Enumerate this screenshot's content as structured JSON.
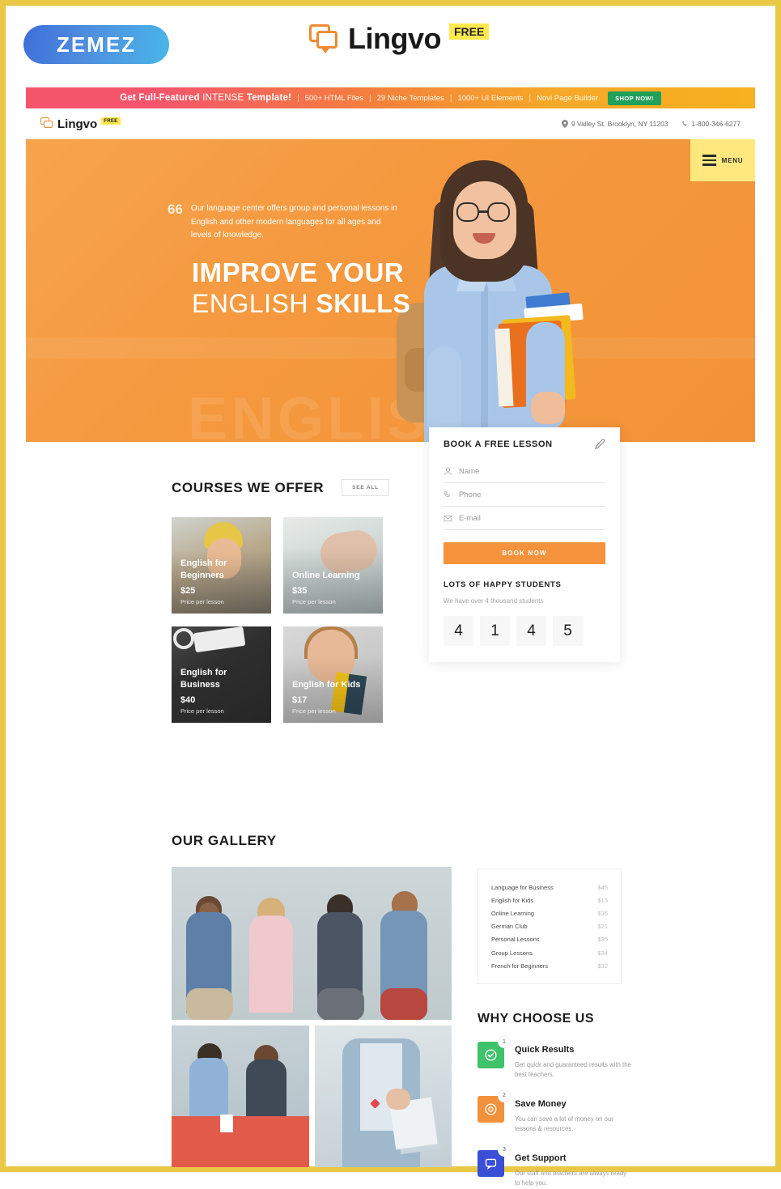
{
  "brand": {
    "zemez_label": "ZEMEZ",
    "logo_word": "Lingvo",
    "free_badge": "FREE"
  },
  "promo": {
    "headline_plain": "Get Full-Featured ",
    "headline_accent": "INTENSE",
    "headline_tail": " Template!",
    "items": [
      "500+ HTML Files",
      "29 Niche Templates",
      "1000+ UI Elements",
      "Novi Page Builder"
    ],
    "cta": "SHOP NOW!",
    "separator": "|"
  },
  "header": {
    "logo_word": "Lingvo",
    "free_badge": "FREE",
    "address": "9 Valley St. Brooklyn, NY 11203",
    "phone": "1-800-346-6277",
    "menu_label": "MENU"
  },
  "hero": {
    "quote_mark": "66",
    "quote_text": "Our language center offers group and personal lessons in English and other modern languages for all ages and levels of knowledge.",
    "title_line1": "IMPROVE YOUR",
    "title_line2_light": "ENGLISH",
    "title_line2_bold": "SKILLS",
    "ghost_text": "ENGLISH",
    "accent_color": "#f5993f",
    "menu_bg": "#ffe97f"
  },
  "booking": {
    "title": "BOOK A FREE LESSON",
    "fields": [
      {
        "name": "Name",
        "placeholder": "Name",
        "value": "",
        "icon": "user-icon"
      },
      {
        "name": "Phone",
        "placeholder": "Phone",
        "value": "",
        "icon": "phone-icon"
      },
      {
        "name": "E-mail",
        "placeholder": "E-mail",
        "value": "",
        "icon": "mail-icon"
      }
    ],
    "submit_label": "BOOK NOW",
    "stats_title": "LOTS OF HAPPY STUDENTS",
    "stats_sub": "We have over 4 thousand students",
    "counter_digits": [
      "4",
      "1",
      "4",
      "5"
    ]
  },
  "courses": {
    "title": "COURSES WE OFFER",
    "see_all": "SEE ALL",
    "items": [
      {
        "name": "English for Beginners",
        "price": "$25",
        "per": "Price per lesson"
      },
      {
        "name": "Online Learning",
        "price": "$35",
        "per": "Price per lesson"
      },
      {
        "name": "English for Business",
        "price": "$40",
        "per": "Price per lesson"
      },
      {
        "name": "English for Kids",
        "price": "$17",
        "per": "Price per lesson"
      }
    ]
  },
  "gallery": {
    "title": "OUR GALLERY"
  },
  "price_list": {
    "rows": [
      {
        "name": "Language for Business",
        "price": "$45"
      },
      {
        "name": "English for Kids",
        "price": "$15"
      },
      {
        "name": "Online Learning",
        "price": "$36"
      },
      {
        "name": "German Club",
        "price": "$21"
      },
      {
        "name": "Personal Lessons",
        "price": "$35"
      },
      {
        "name": "Group Lessons",
        "price": "$34"
      },
      {
        "name": "French for Beginners",
        "price": "$32"
      }
    ]
  },
  "why": {
    "title": "WHY CHOOSE US",
    "features": [
      {
        "num": "1",
        "title": "Quick Results",
        "desc": "Get quick and guaranteed results with the best teachers.",
        "color": "#3fc26a",
        "icon": "check-circle-icon"
      },
      {
        "num": "2",
        "title": "Save Money",
        "desc": "You can save a lot of money on our lessons & resources.",
        "color": "#f2913c",
        "icon": "coin-icon"
      },
      {
        "num": "3",
        "title": "Get Support",
        "desc": "Our staff and teachers are always ready to help you.",
        "color": "#3a4ed6",
        "icon": "support-chat-icon"
      }
    ]
  }
}
